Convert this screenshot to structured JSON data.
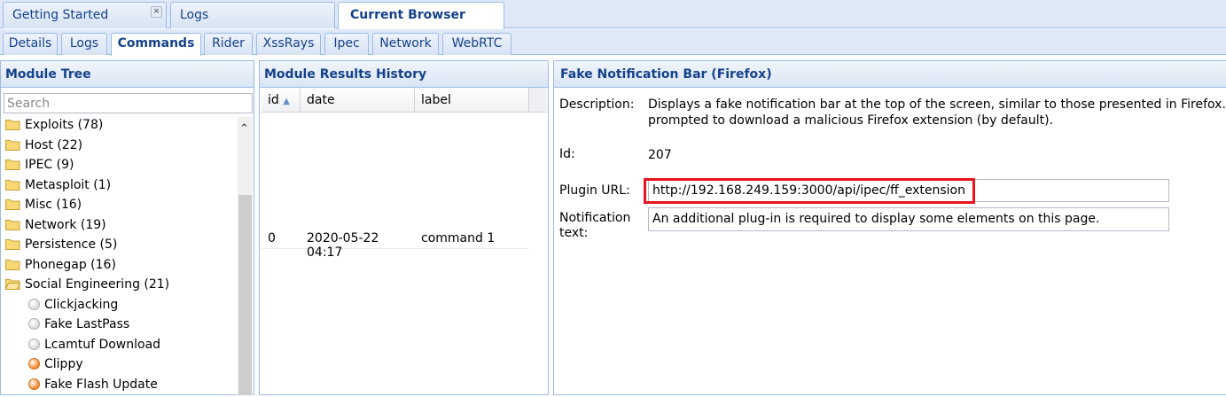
{
  "top_tabs": [
    {
      "label": "Getting Started",
      "close": "×"
    },
    {
      "label": "Logs"
    },
    {
      "label": "Current Browser"
    }
  ],
  "sub_tabs": [
    "Details",
    "Logs",
    "Commands",
    "Rider",
    "XssRays",
    "Ipec",
    "Network",
    "WebRTC"
  ],
  "module_tree": {
    "title": "Module Tree",
    "search_placeholder": "Search",
    "items": [
      "Exploits (78)",
      "Host (22)",
      "IPEC (9)",
      "Metasploit (1)",
      "Misc (16)",
      "Network (19)",
      "Persistence (5)",
      "Phonegap (16)",
      "Social Engineering (21)"
    ],
    "children": [
      "Clickjacking",
      "Fake LastPass",
      "Lcamtuf Download",
      "Clippy",
      "Fake Flash Update"
    ]
  },
  "history": {
    "title": "Module Results History",
    "headers": [
      "id",
      "date",
      "label"
    ],
    "sort_arrow": "▲",
    "rows": [
      [
        "0",
        "2020-05-22 04:17",
        "command 1"
      ]
    ]
  },
  "module": {
    "title": "Fake Notification Bar (Firefox)",
    "description_label": "Description:",
    "description_line1": "Displays a fake notification bar at the top of the screen, similar to those presented in Firefox. If the user click",
    "description_line2": "prompted to download a malicious Firefox extension (by default).",
    "id_label": "Id:",
    "id_value": "207",
    "plugin_label": "Plugin URL:",
    "plugin_value": "http://192.168.249.159:3000/api/ipec/ff_extension",
    "notif_label_1": "Notification",
    "notif_label_2": "text:",
    "notif_value": "An additional plug-in is required to display some elements on this page."
  },
  "colors": {
    "highlight": "#e8141c",
    "header_text": "#15428b",
    "border": "#99bbe8"
  }
}
